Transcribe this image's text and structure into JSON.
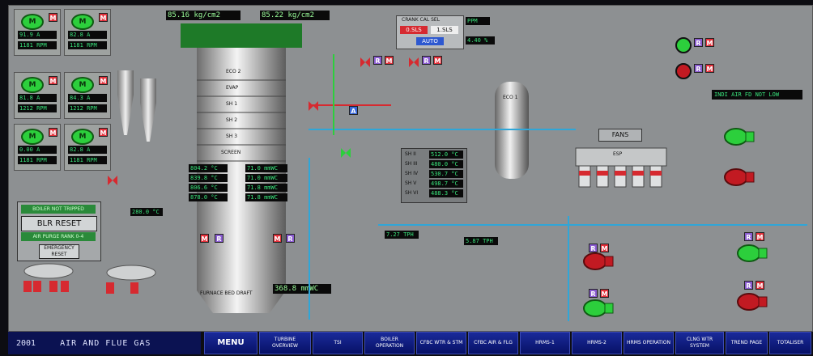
{
  "top": {
    "pressure1": "85.16 kg/cm2",
    "pressure2": "85.22 kg/cm2",
    "ctrl_title": "CRANK CAL SEL",
    "ctrl_value_red": "0.SLS",
    "ctrl_value_white": "1.SLS",
    "auto_label": "AUTO",
    "ctrl_ppm": "PPM",
    "ctrl_pct": "4.40 %"
  },
  "feed_pumps": [
    {
      "state": "M",
      "amps": "91.9 A",
      "rpm": "1181 RPM"
    },
    {
      "state": "M",
      "amps": "82.8 A",
      "rpm": "1181 RPM"
    },
    {
      "state": "M",
      "amps": "81.8 A",
      "rpm": "1212 RPM"
    },
    {
      "state": "M",
      "amps": "84.3 A",
      "rpm": "1212 RPM"
    },
    {
      "state": "M",
      "amps": "0.00 A",
      "rpm": "1181 RPM"
    },
    {
      "state": "M",
      "amps": "82.8 A",
      "rpm": "1181 RPM"
    }
  ],
  "boiler": {
    "sections": [
      "ECO 2",
      "EVAP",
      "SH 1",
      "SH 2",
      "SH 3",
      "SCREEN"
    ],
    "drum_label": "ECO 1",
    "bottom_label": "FURNACE BED DRAFT",
    "bed_draft_value": "368.8 mmWC"
  },
  "temps_left": [
    "804.2 °C",
    "839.8 °C",
    "806.6 °C",
    "878.0 °C"
  ],
  "temps_right": [
    "71.0 mmWC",
    "71.0 mmWC",
    "71.8 mmWC",
    "71.8 mmWC"
  ],
  "drum_table": {
    "rows": [
      "SH II",
      "SH III",
      "SH IV",
      "SH V",
      "SH VI"
    ],
    "values": [
      "512.0 °C",
      "480.0 °C",
      "530.7 °C",
      "498.7 °C",
      "488.3 °C"
    ]
  },
  "left_panel": {
    "status1": "BOILER NOT TRIPPED",
    "reset": "BLR RESET",
    "status2": "AIR PURGE  RANK 0-4",
    "emergency": "EMERGENCY RESET"
  },
  "misc": {
    "insid_flag": "INDI AIR FD NOT LOW",
    "fans_label": "FANS",
    "esp_label": "ESP",
    "tph_left": "7.27 TPH",
    "tph_right": "5.87 TPH",
    "temp_ash": "280.0 °C"
  },
  "footer": {
    "code": "2001",
    "title": "AIR AND FLUE GAS",
    "menu": "MENU",
    "nav": [
      "TURBINE OVERVIEW",
      "TSI",
      "BOILER OPERATION",
      "CFBC WTR & STM",
      "CFBC AIR & FLG",
      "HRMS-1",
      "HRMS-2",
      "HRMS OPERATION",
      "CLNG WTR SYSTEM",
      "TREND PAGE",
      "TOTALISER"
    ]
  },
  "colors": {
    "panel": "#8d9092",
    "digit": "#39e27b",
    "pump_on": "#2ccf3c",
    "alarm": "#e2303a",
    "remote": "#8a5ccf",
    "nav": "#0b1a8a"
  }
}
